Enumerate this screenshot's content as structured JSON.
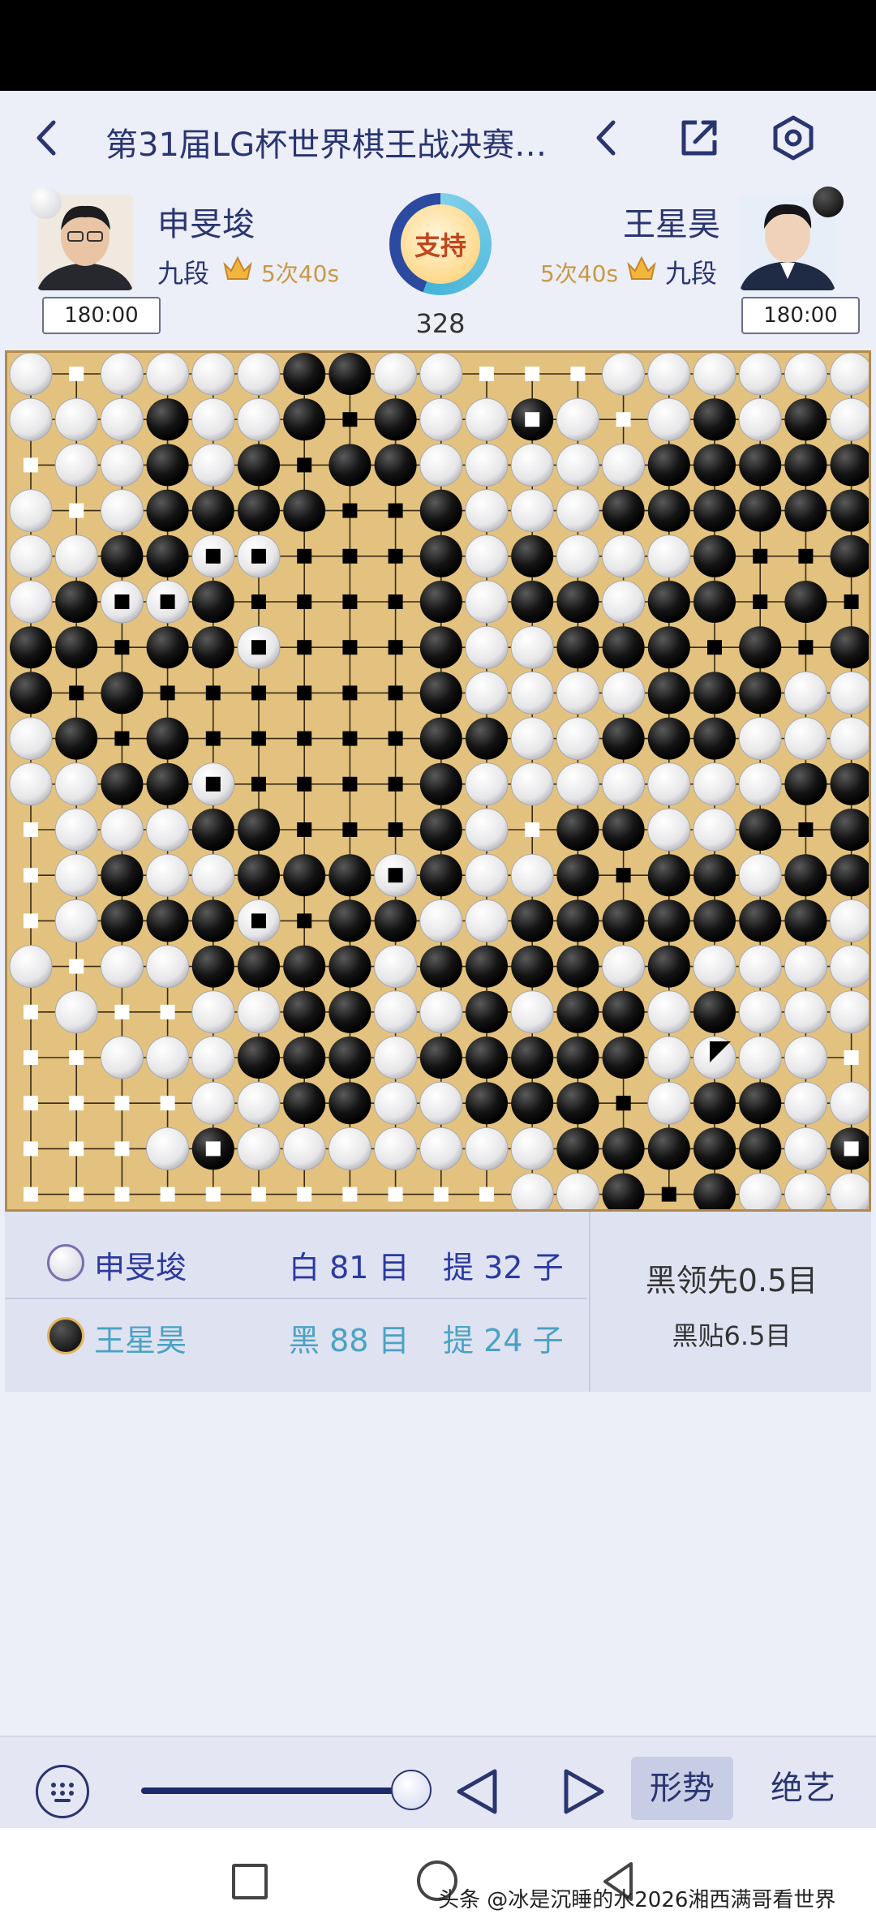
{
  "titlebar": {
    "title": "第31届LG杯世界棋王战决赛…",
    "back_icon": "chevron-left-icon",
    "prev_icon": "chevron-left-icon",
    "share_icon": "share-icon",
    "settings_icon": "settings-icon"
  },
  "players": {
    "white": {
      "name": "申旻埈",
      "rank": "九段",
      "byoyomi": "5次40s",
      "clock": "180:00",
      "stone": "white"
    },
    "black": {
      "name": "王星昊",
      "rank": "九段",
      "byoyomi": "5次40s",
      "clock": "180:00",
      "stone": "black"
    }
  },
  "support_label": "支持",
  "move_number": "328",
  "board": {
    "size": 19,
    "rows": [
      "WwWWWWBBWWwwwWWWWWW",
      "WWWBWWBxBWWBWwWBWBW",
      "wWWBWBxBBWWWWWBBBBB",
      "WwWBBBBxxBWWWBBBBBB",
      "WWBBWWxxxBWBWWWBxxB",
      "WBWWBxxxxBWBBWBBxBx",
      "BBxBBWxxxBWWBBBxBxB",
      "BxBxxxxxxBWWWWBBBWW",
      "WBxBxxxxxBBWWBBBWWW",
      "WWBBWxxxxBWWWWWWWBB",
      "wWWWBBxxxBWwBBWWBxB",
      "wWBWWBBBWBWWBxBBWBB",
      "wWBBBWxBBWWBBBBBBBW",
      "WwWWBBBBWBBBBWBWWWW",
      "wWwwWWBBWWBWBBWBWWW",
      "wwWWWBBBWBBBBBWWWWw",
      "wwwwWWBBWWBBBxWBBWW",
      "wwwWBWWWWWWWBBBBBWB",
      "wwwwwwwwwwwWWBxBWWW"
    ],
    "last_move_marker": "triangle",
    "legend": {
      "W": "white stone",
      "B": "black stone",
      "w": "white territory mark",
      "x": "black territory mark"
    }
  },
  "score": {
    "white_row": {
      "name": "申旻埈",
      "color_label": "白",
      "points": "81",
      "points_unit": "目",
      "captures_label": "提",
      "captures": "32",
      "captures_unit": "子"
    },
    "black_row": {
      "name": "王星昊",
      "color_label": "黑",
      "points": "88",
      "points_unit": "目",
      "captures_label": "提",
      "captures": "24",
      "captures_unit": "子"
    },
    "lead_text": "黑领先0.5目",
    "komi_text": "黑贴6.5目"
  },
  "bottombar": {
    "keyboard_icon": "keyboard-icon",
    "slider_value": 1.0,
    "prev_icon": "triangle-left-icon",
    "next_icon": "triangle-right-icon",
    "trend_label": "形势",
    "ai_label": "绝艺"
  },
  "sysnav": {
    "watermark": "头条 @冰是沉睡的水2026湘西满哥看世界"
  }
}
